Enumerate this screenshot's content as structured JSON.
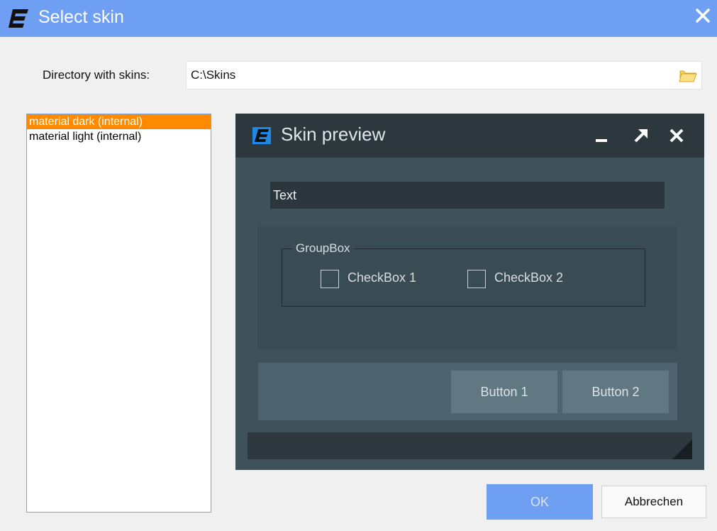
{
  "window": {
    "title": "Select skin",
    "accent_color": "#6f9ff2"
  },
  "directory": {
    "label": "Directory with skins:",
    "value": "C:\\Skins",
    "icon": "folder-icon"
  },
  "skins": [
    {
      "label": "material dark (internal)",
      "selected": true
    },
    {
      "label": "material light (internal)",
      "selected": false
    }
  ],
  "preview": {
    "title": "Skin preview",
    "text_value": "Text",
    "groupbox_label": "GroupBox",
    "checkbox1": "CheckBox 1",
    "checkbox2": "CheckBox 2",
    "button1": "Button 1",
    "button2": "Button 2"
  },
  "dialog": {
    "ok_label": "OK",
    "cancel_label": "Abbrechen"
  }
}
